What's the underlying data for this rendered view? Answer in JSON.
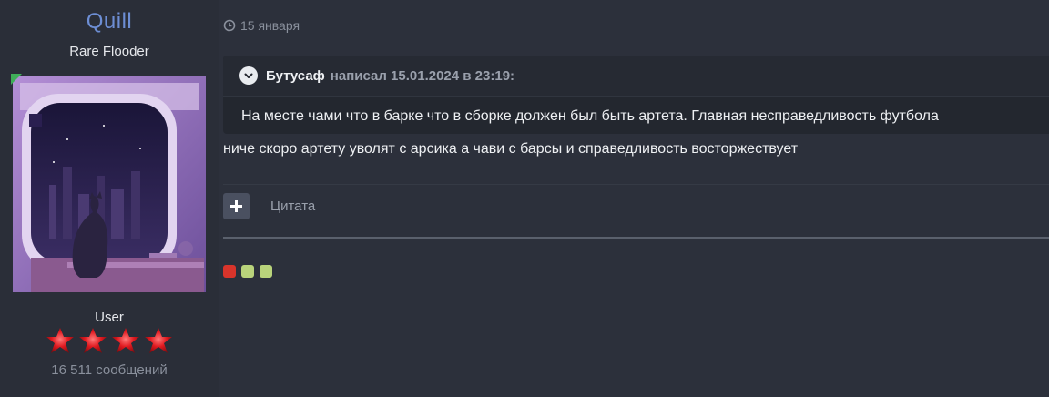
{
  "author": {
    "name": "Quill",
    "title": "Rare Flooder",
    "group": "User",
    "message_count": "16 511 сообщений",
    "rank_stars": 4
  },
  "post": {
    "date": "15 января",
    "quote": {
      "author": "Бутусаф",
      "meta": "написал 15.01.2024 в 23:19:",
      "text": "На месте чами что в барке что в сборке должен был быть артета. Главная несправедливость футбола"
    },
    "text": "ниче скоро артету уволят с арсика а чави с барсы и справедливость восторжествует",
    "actions": {
      "quote_label": "Цитата"
    }
  },
  "colors": {
    "background": "#2c303b",
    "author_name": "#6d8ed4",
    "avatar_corner": "#3fae59",
    "dot_red": "#d9342b",
    "dot_green": "#b9d37b"
  },
  "status_dots": [
    "red",
    "green",
    "green"
  ]
}
